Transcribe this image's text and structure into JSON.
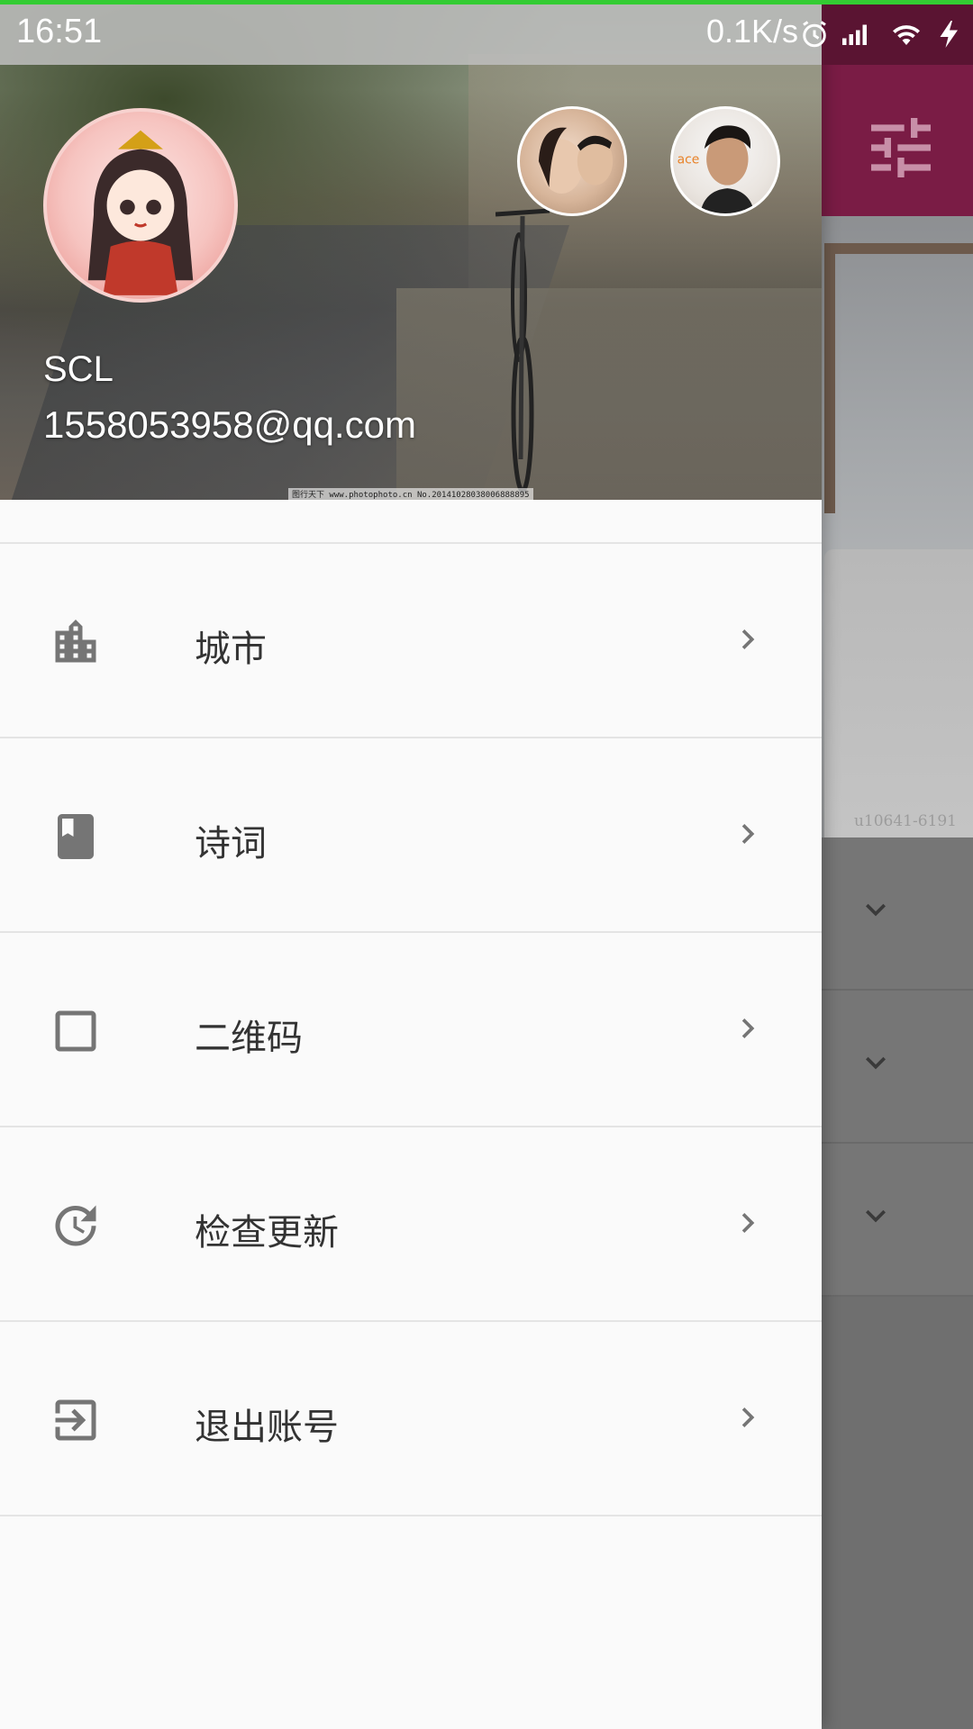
{
  "status_bar": {
    "time": "16:51",
    "network_speed": "0.1K/s",
    "icons": [
      "alarm-icon",
      "signal-icon",
      "wifi-icon",
      "charging-icon"
    ],
    "progress_color": "#33cc33"
  },
  "background_screen": {
    "appbar_color": "#7a1c45",
    "filter_icon": "tune-icon",
    "photo_watermark": "u10641-6191",
    "cards": [
      {
        "icon": "chevron-down-icon"
      },
      {
        "icon": "chevron-down-icon"
      },
      {
        "icon": "chevron-down-icon"
      }
    ]
  },
  "drawer": {
    "header": {
      "user_name": "SCL",
      "email": "1558053958@qq.com",
      "image_note": "图行天下 www.photophoto.cn No.20141028038006888895",
      "avatars": [
        "main-avatar",
        "couple-avatar",
        "man-avatar"
      ]
    },
    "menu": [
      {
        "label": "城市",
        "icon": "city-icon"
      },
      {
        "label": "诗词",
        "icon": "book-icon"
      },
      {
        "label": "二维码",
        "icon": "square-icon"
      },
      {
        "label": "检查更新",
        "icon": "update-icon"
      },
      {
        "label": "退出账号",
        "icon": "exit-icon"
      }
    ],
    "icon_color": "#757575",
    "arrow_color": "#757575"
  }
}
